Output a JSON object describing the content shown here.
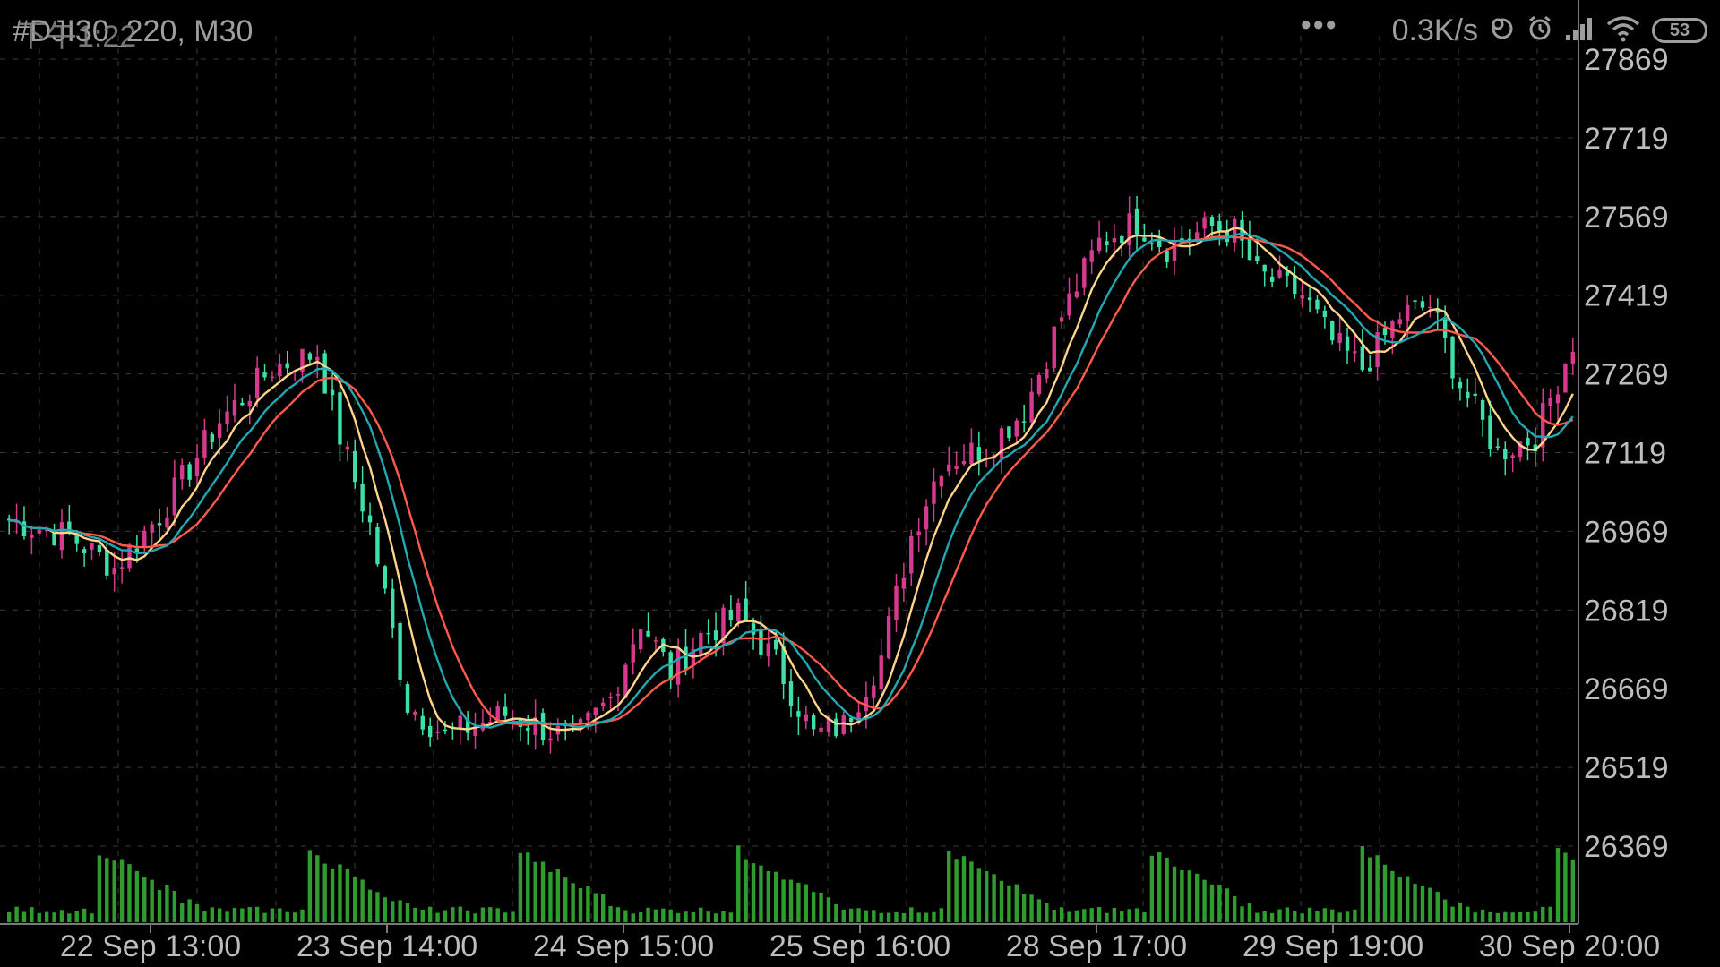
{
  "status_bar": {
    "time": "下午1:22",
    "symbol_label": "#DJI30_220, M30",
    "menu_dots": "•••",
    "network_speed": "0.3K/s",
    "battery": "53",
    "icons": [
      "sync-icon",
      "alarm-icon",
      "signal-icon",
      "wifi-icon",
      "battery-icon"
    ]
  },
  "colors": {
    "background": "#000000",
    "grid": "#3a3a3a",
    "bull_candle": "#d63a8e",
    "bear_candle": "#3de0a8",
    "volume": "#2e9d2e",
    "ma_fast": "#ffd58a",
    "ma_mid": "#ff5a4a",
    "ma_slow": "#21a8b0",
    "axis_text": "#bdbdbd"
  },
  "chart_data": {
    "type": "candlestick",
    "symbol": "#DJI30_220",
    "timeframe": "M30",
    "price_axis_ticks": [
      27869,
      27719,
      27569,
      27419,
      27269,
      27119,
      26969,
      26819,
      26669,
      26519,
      26369
    ],
    "ylim": [
      26310,
      27900
    ],
    "time_axis_labels": [
      "22 Sep 13:00",
      "23 Sep 14:00",
      "24 Sep 15:00",
      "25 Sep 16:00",
      "28 Sep 17:00",
      "29 Sep 19:00",
      "30 Sep 20:00"
    ],
    "grid": true,
    "close_anchors": [
      [
        0,
        26990
      ],
      [
        8,
        26960
      ],
      [
        14,
        26900
      ],
      [
        20,
        27000
      ],
      [
        28,
        27180
      ],
      [
        35,
        27280
      ],
      [
        41,
        27310
      ],
      [
        44,
        27150
      ],
      [
        48,
        26980
      ],
      [
        53,
        26640
      ],
      [
        58,
        26580
      ],
      [
        62,
        26600
      ],
      [
        66,
        26620
      ],
      [
        70,
        26600
      ],
      [
        75,
        26570
      ],
      [
        80,
        26650
      ],
      [
        84,
        26800
      ],
      [
        88,
        26700
      ],
      [
        92,
        26770
      ],
      [
        97,
        26810
      ],
      [
        102,
        26720
      ],
      [
        107,
        26580
      ],
      [
        111,
        26600
      ],
      [
        116,
        26730
      ],
      [
        120,
        26960
      ],
      [
        124,
        27100
      ],
      [
        130,
        27130
      ],
      [
        135,
        27200
      ],
      [
        140,
        27380
      ],
      [
        145,
        27520
      ],
      [
        150,
        27560
      ],
      [
        154,
        27510
      ],
      [
        160,
        27550
      ],
      [
        163,
        27540
      ],
      [
        166,
        27460
      ],
      [
        172,
        27420
      ],
      [
        176,
        27330
      ],
      [
        180,
        27280
      ],
      [
        185,
        27380
      ],
      [
        189,
        27400
      ],
      [
        193,
        27250
      ],
      [
        198,
        27120
      ],
      [
        203,
        27150
      ],
      [
        208,
        27330
      ]
    ],
    "indicators": [
      {
        "type": "moving-average",
        "period": 6
      },
      {
        "type": "moving-average",
        "period": 14
      },
      {
        "type": "moving-average",
        "period": 10
      }
    ],
    "volume_peaks": [
      12,
      40,
      68,
      97,
      125,
      152,
      180,
      206
    ]
  }
}
